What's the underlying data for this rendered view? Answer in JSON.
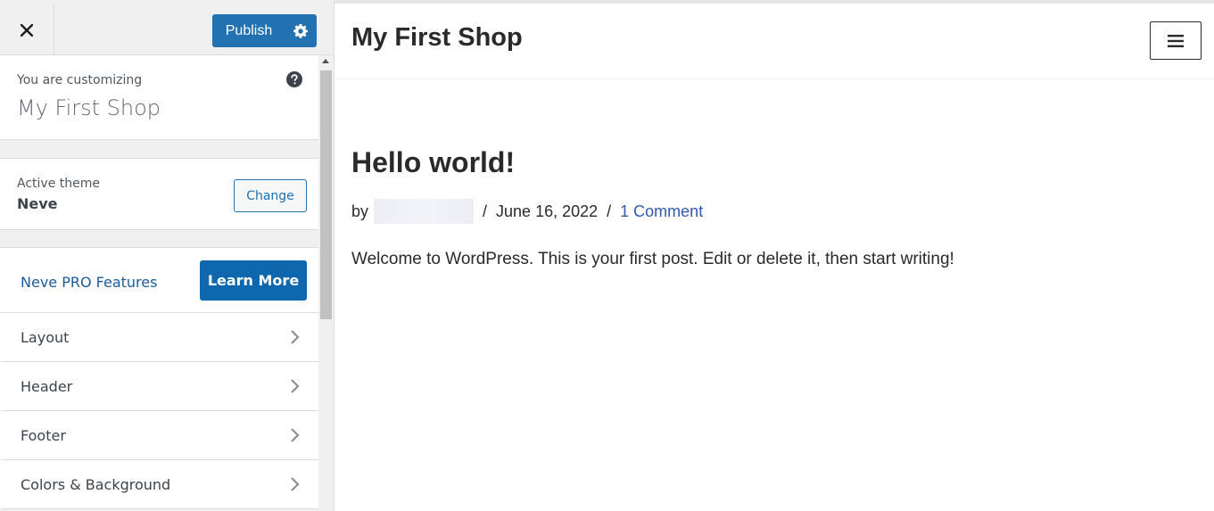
{
  "customizer": {
    "close_icon": "close-icon",
    "publish_label": "Publish",
    "publish_settings_icon": "gear-icon",
    "info": {
      "label": "You are customizing",
      "site_name": "My First Shop",
      "help_icon": "help-icon"
    },
    "theme": {
      "label": "Active theme",
      "name": "Neve",
      "change_label": "Change"
    },
    "pro": {
      "label": "Neve PRO Features",
      "button_label": "Learn More"
    },
    "sections": [
      {
        "label": "Layout"
      },
      {
        "label": "Header"
      },
      {
        "label": "Footer"
      },
      {
        "label": "Colors & Background"
      }
    ],
    "colors": {
      "primary": "#2271b1",
      "learn_more": "#0f67ad",
      "sidebar_bg": "#f0f0f1"
    }
  },
  "preview": {
    "site_title": "My First Shop",
    "menu_icon": "hamburger-icon",
    "post": {
      "title": "Hello world!",
      "by_label": "by",
      "separator": "/",
      "date": "June 16, 2022",
      "comments": "1 Comment",
      "body": "Welcome to WordPress. This is your first post. Edit or delete it, then start writing!"
    },
    "colors": {
      "link": "#2f5aae"
    }
  }
}
